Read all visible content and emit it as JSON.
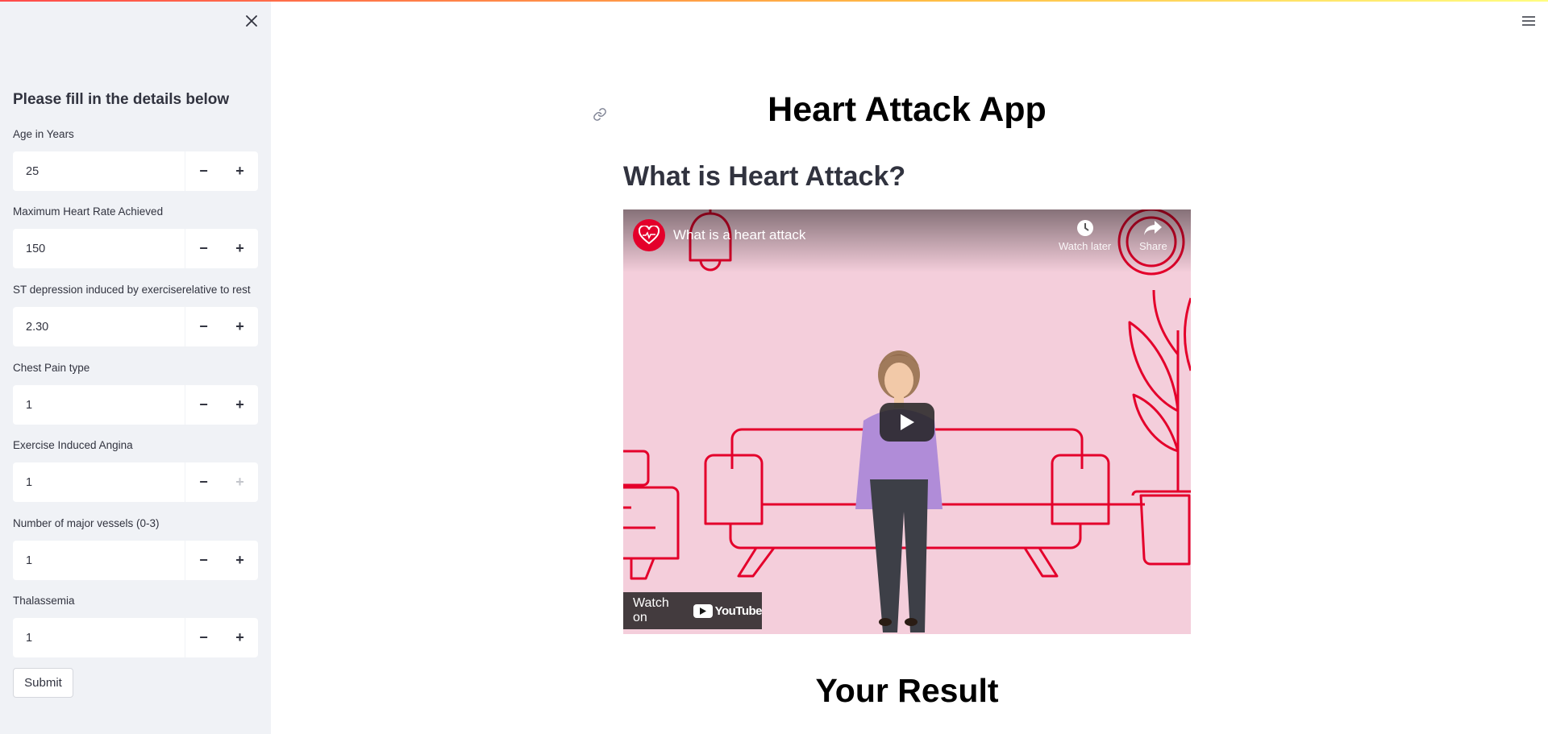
{
  "sidebar": {
    "title": "Please fill in the details below",
    "fields": [
      {
        "label": "Age in Years",
        "value": "25"
      },
      {
        "label": "Maximum Heart Rate Achieved",
        "value": "150"
      },
      {
        "label": "ST depression induced by exerciserelative to rest",
        "value": "2.30"
      },
      {
        "label": "Chest Pain type",
        "value": "1"
      },
      {
        "label": "Exercise Induced Angina",
        "value": "1",
        "plus_disabled": true
      },
      {
        "label": "Number of major vessels (0-3)",
        "value": "1"
      },
      {
        "label": "Thalassemia",
        "value": "1"
      }
    ],
    "minus_label": "−",
    "plus_label": "+",
    "submit_label": "Submit"
  },
  "main": {
    "title": "Heart Attack App",
    "section_heading": "What is Heart Attack?",
    "video": {
      "title": "What is a heart attack",
      "watch_later": "Watch later",
      "share": "Share",
      "watch_on": "Watch on",
      "youtube": "YouTube"
    },
    "result_heading": "Your Result"
  },
  "colors": {
    "accent_start": "#ff4b4b",
    "accent_end": "#fffd80",
    "sidebar_bg": "#f0f2f6",
    "video_bg": "#f4cedb",
    "illustration_red": "#e4002b"
  }
}
